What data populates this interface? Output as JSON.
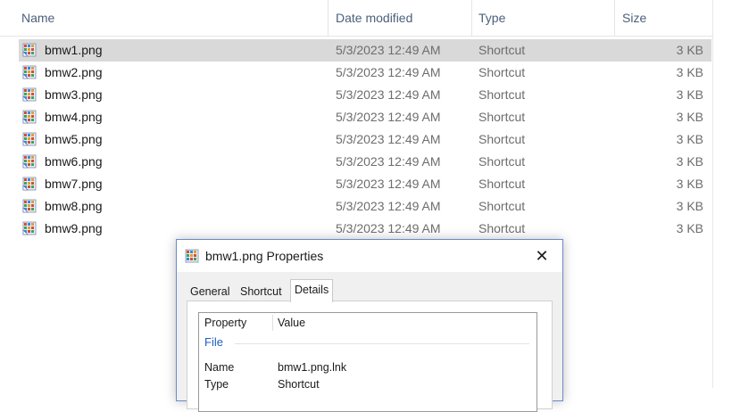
{
  "columns": {
    "name": "Name",
    "date_modified": "Date modified",
    "type": "Type",
    "size": "Size"
  },
  "files": [
    {
      "name": "bmw1.png",
      "date": "5/3/2023 12:49 AM",
      "type": "Shortcut",
      "size": "3 KB",
      "selected": true
    },
    {
      "name": "bmw2.png",
      "date": "5/3/2023 12:49 AM",
      "type": "Shortcut",
      "size": "3 KB"
    },
    {
      "name": "bmw3.png",
      "date": "5/3/2023 12:49 AM",
      "type": "Shortcut",
      "size": "3 KB"
    },
    {
      "name": "bmw4.png",
      "date": "5/3/2023 12:49 AM",
      "type": "Shortcut",
      "size": "3 KB"
    },
    {
      "name": "bmw5.png",
      "date": "5/3/2023 12:49 AM",
      "type": "Shortcut",
      "size": "3 KB"
    },
    {
      "name": "bmw6.png",
      "date": "5/3/2023 12:49 AM",
      "type": "Shortcut",
      "size": "3 KB"
    },
    {
      "name": "bmw7.png",
      "date": "5/3/2023 12:49 AM",
      "type": "Shortcut",
      "size": "3 KB"
    },
    {
      "name": "bmw8.png",
      "date": "5/3/2023 12:49 AM",
      "type": "Shortcut",
      "size": "3 KB"
    },
    {
      "name": "bmw9.png",
      "date": "5/3/2023 12:49 AM",
      "type": "Shortcut",
      "size": "3 KB"
    }
  ],
  "file_icon": "image-file-shortcut-icon",
  "dialog": {
    "title": "bmw1.png Properties",
    "close_glyph": "✕",
    "tabs": [
      "General",
      "Shortcut",
      "Details"
    ],
    "active_tab": "Details",
    "headers": {
      "property": "Property",
      "value": "Value"
    },
    "group": "File",
    "rows": [
      {
        "property": "Name",
        "value": "bmw1.png.lnk"
      },
      {
        "property": "Type",
        "value": "Shortcut"
      }
    ]
  },
  "colors": {
    "selection": "#d9d9d9",
    "header_text": "#4c607a",
    "group_text": "#1f5fbf",
    "dialog_border": "#6b8ac9"
  }
}
